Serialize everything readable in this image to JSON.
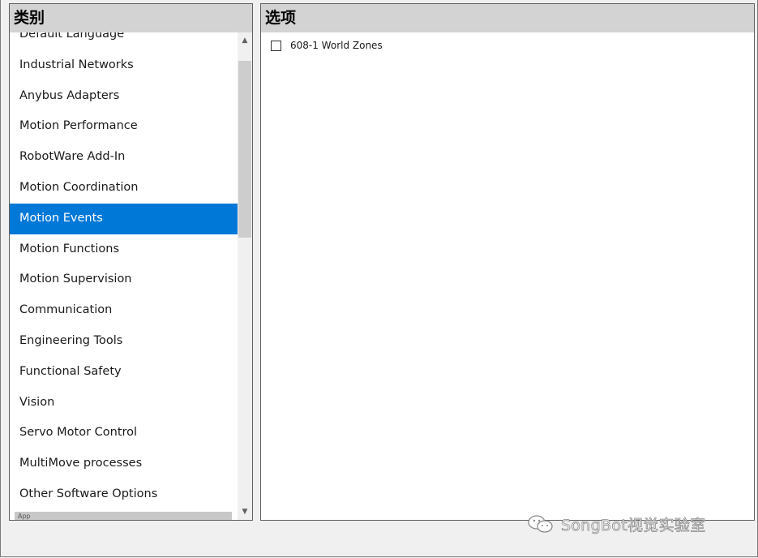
{
  "categories_panel": {
    "title": "类别",
    "items": [
      {
        "label": "Default Language"
      },
      {
        "label": "Industrial Networks"
      },
      {
        "label": "Anybus Adapters"
      },
      {
        "label": "Motion Performance"
      },
      {
        "label": "RobotWare Add-In"
      },
      {
        "label": "Motion Coordination"
      },
      {
        "label": "Motion Events",
        "selected": true
      },
      {
        "label": "Motion Functions"
      },
      {
        "label": "Motion Supervision"
      },
      {
        "label": "Communication"
      },
      {
        "label": "Engineering Tools"
      },
      {
        "label": "Functional Safety"
      },
      {
        "label": "Vision"
      },
      {
        "label": "Servo Motor Control"
      },
      {
        "label": "MultiMove processes"
      },
      {
        "label": "Other Software Options"
      },
      {
        "label": "App"
      }
    ]
  },
  "options_panel": {
    "title": "选项",
    "options": [
      {
        "label": "608-1 World Zones",
        "checked": false
      }
    ]
  },
  "watermark": {
    "icon": "wechat-icon",
    "text": "SongBot视觉实验室"
  },
  "colors": {
    "selection": "#0078d7",
    "header_bg": "#d3d3d3",
    "window_bg": "#f0f0f0"
  }
}
